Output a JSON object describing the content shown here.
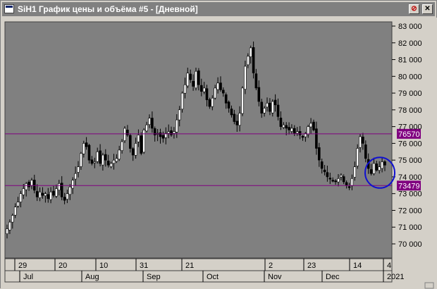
{
  "window": {
    "title": "SiH1 График цены и объёма #5 - [Дневной]",
    "pin_glyph": "⊘",
    "close_glyph": "✕",
    "icon": "chart-window-icon"
  },
  "colors": {
    "plot_bg": "#808080",
    "frame_bg": "#d4d0c8",
    "candle": "#000000",
    "level_line": "#800080",
    "level_label_bg": "#800080",
    "annotation": "#1010d0"
  },
  "chart_data": {
    "type": "candlestick",
    "symbol": "SiH1",
    "timeframe": "Дневной",
    "y_ticks": [
      "83 000",
      "82 000",
      "81 000",
      "80 000",
      "79 000",
      "78 000",
      "77 000",
      "76 000",
      "75 000",
      "74 000",
      "73 000",
      "72 000",
      "71 000",
      "70 000"
    ],
    "y_tick_values": [
      83000,
      82000,
      81000,
      80000,
      79000,
      78000,
      77000,
      76000,
      75000,
      74000,
      73000,
      72000,
      71000,
      70000
    ],
    "ylim": [
      69200,
      83250
    ],
    "x_day_labels": [
      "29",
      "20",
      "10",
      "31",
      "21",
      "2",
      "23",
      "14",
      "4"
    ],
    "x_month_labels": [
      "Jul",
      "Aug",
      "Sep",
      "Oct",
      "Nov",
      "Dec",
      "2021"
    ],
    "horizontal_levels": [
      {
        "value": 76570,
        "label": "76570"
      },
      {
        "value": 73479,
        "label": "73479"
      }
    ],
    "annotation": {
      "type": "ellipse",
      "around": "last candles",
      "from_value": 73500,
      "to_value": 75000
    },
    "close_path": [
      70900,
      71300,
      71700,
      72200,
      72500,
      73000,
      73300,
      73600,
      73400,
      73800,
      73200,
      72800,
      73100,
      72900,
      73000,
      72700,
      73100,
      72900,
      73300,
      73600,
      72800,
      72600,
      73000,
      73400,
      73800,
      74200,
      74600,
      75400,
      76000,
      75800,
      75000,
      74800,
      74900,
      75500,
      74800,
      75300,
      75000,
      74700,
      74800,
      75000,
      75100,
      75600,
      76100,
      76900,
      76500,
      75700,
      75300,
      76000,
      76500,
      75400,
      76800,
      77100,
      77500,
      76900,
      76500,
      76600,
      76400,
      76300,
      76600,
      76700,
      76500,
      76700,
      77400,
      78000,
      79000,
      79500,
      80200,
      79800,
      79400,
      80300,
      79500,
      79100,
      79300,
      78600,
      78200,
      78700,
      79300,
      79600,
      79200,
      79000,
      78400,
      78100,
      77700,
      77300,
      77100,
      77800,
      79300,
      80600,
      81200,
      81700,
      80200,
      79300,
      78500,
      77800,
      78100,
      78400,
      77900,
      78500,
      78300,
      77600,
      77000,
      77100,
      76900,
      76800,
      76900,
      76600,
      76700,
      76500,
      76400,
      76600,
      77000,
      77200,
      76800,
      75700,
      75000,
      74500,
      74300,
      74000,
      73900,
      73800,
      73700,
      73900,
      74100,
      73700,
      73500,
      73400,
      73900,
      74600,
      75700,
      76400,
      76000,
      75100,
      74500,
      74200,
      74800,
      74400,
      74600,
      74900,
      74700
    ]
  }
}
